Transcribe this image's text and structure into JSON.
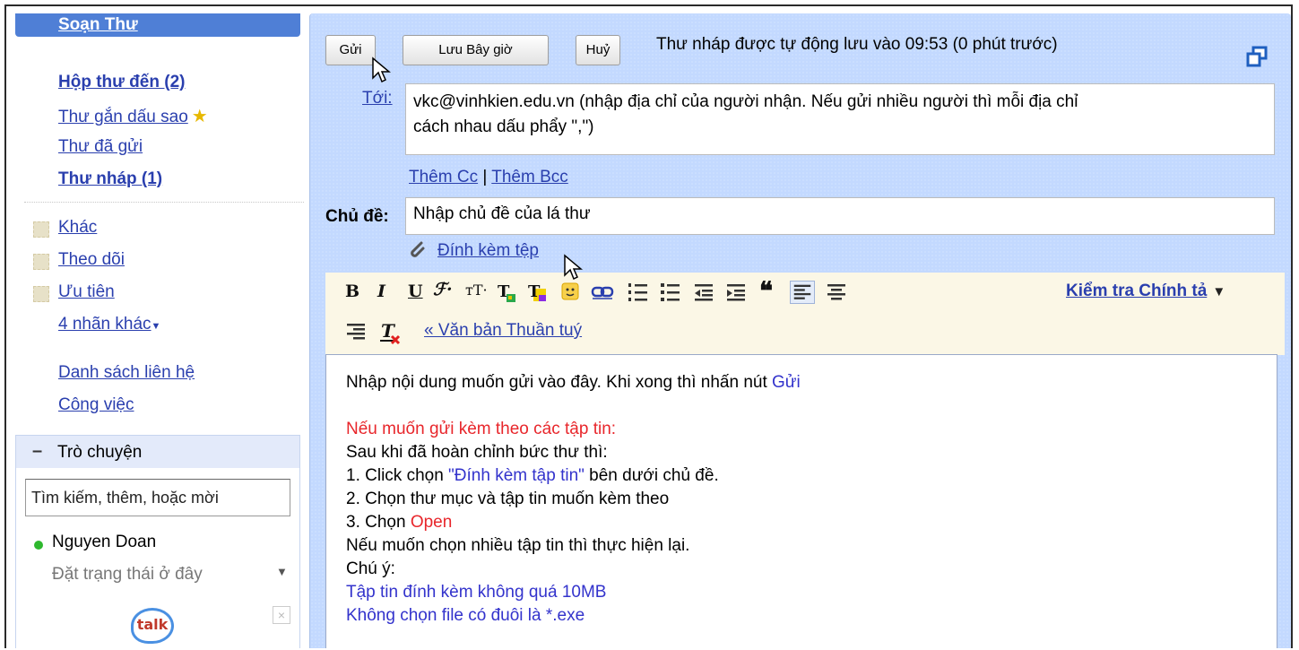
{
  "sidebar": {
    "compose": "Soạn Thư",
    "nav": {
      "inbox": "Hộp thư đến (2)",
      "starred": "Thư gắn dấu sao",
      "sent": "Thư đã gửi",
      "drafts": "Thư nháp (1)"
    },
    "labels": [
      "Khác",
      "Theo dõi",
      "Ưu tiên"
    ],
    "more_labels": "4 nhãn khác",
    "contacts": "Danh sách liên hệ",
    "tasks": "Công việc",
    "chat": {
      "title": "Trò chuyện",
      "search_value": "Tìm kiếm, thêm, hoặc mời",
      "user_name": "Nguyen Doan",
      "status_placeholder": "Đặt trạng thái ở đây",
      "talk_logo": "talk"
    }
  },
  "compose": {
    "send_button": "Gửi",
    "save_button": "Lưu Bây giờ",
    "discard_button": "Huỷ",
    "autosave_text": "Thư nháp được tự động lưu vào 09:53 (0 phút trước)",
    "to_label": "Tới:",
    "to_value_line1": "vkc@vinhkien.edu.vn (nhập địa chỉ của người nhận. Nếu gửi nhiều người thì mỗi địa chỉ",
    "to_value_line2": "cách nhau dấu phẩy \",\")",
    "add_cc": "Thêm Cc",
    "cc_separator": "|",
    "add_bcc": "Thêm Bcc",
    "subject_label": "Chủ đề:",
    "subject_value": "Nhập chủ đề của lá thư",
    "attach_link": "Đính kèm tệp",
    "spell_check": "Kiểm tra Chính tả",
    "plain_text": "« Văn bản Thuần tuý"
  },
  "toolbar": {
    "bold": "B",
    "italic": "I",
    "underline": "U",
    "font": "ℱ",
    "size": "тT",
    "quote": "❝"
  },
  "body": {
    "line1_text": "Nhập nội dung muốn gửi vào đây. Khi xong thì nhấn nút ",
    "line1_highlight": "Gửi",
    "line2": "Nếu muốn gửi kèm theo các tập tin:",
    "line3": "Sau khi đã hoàn chỉnh bức thư thì:",
    "line4_prefix": "1. Click chọn ",
    "line4_highlight": "\"Đính kèm tập tin\"",
    "line4_suffix": " bên dưới chủ đề.",
    "line5": "2. Chọn thư mục và tập tin muốn kèm theo",
    "line6_prefix": "3. Chọn ",
    "line6_highlight": "Open",
    "line7": "Nếu muốn chọn nhiều tập tin thì thực hiện lại.",
    "line8": "Chú ý:",
    "line9": "Tập tin đính kèm không quá 10MB",
    "line10": "Không chọn file có đuôi là   *.exe"
  },
  "colors": {
    "sidebar_accent": "#4f7fd6",
    "compose_bg": "#c3d9ff",
    "link": "#2a3fae",
    "red_text": "#e8262b",
    "blue_text": "#3333cc",
    "status_online": "#2eb82e"
  }
}
